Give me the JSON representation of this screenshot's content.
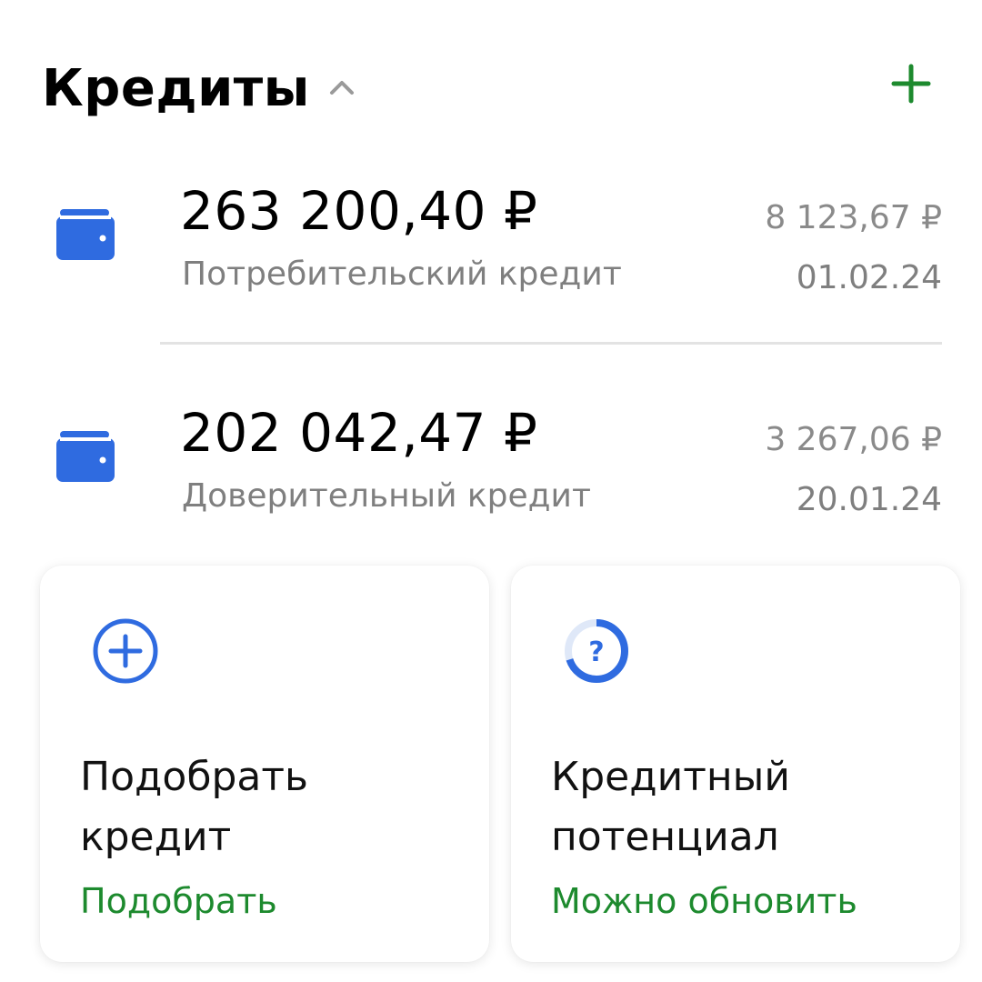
{
  "header": {
    "title": "Кредиты",
    "icons": {
      "collapse": "chevron-up-icon",
      "add": "plus-icon"
    }
  },
  "loans": [
    {
      "amount": "263 200,40 ₽",
      "name": "Потребительский кредит",
      "payment": "8 123,67 ₽",
      "date": "01.02.24",
      "icon": "wallet-icon"
    },
    {
      "amount": "202 042,47 ₽",
      "name": "Доверительный кредит",
      "payment": "3 267,06 ₽",
      "date": "20.01.24",
      "icon": "wallet-icon"
    }
  ],
  "cards": [
    {
      "title": "Подобрать кредит",
      "action": "Подобрать",
      "icon": "plus-circle-icon"
    },
    {
      "title": "Кредитный потенциал",
      "action": "Можно обновить",
      "icon": "question-progress-icon",
      "progress_percent": 70
    }
  ],
  "colors": {
    "accent_green": "#1d8a2e",
    "accent_blue": "#2f6be0",
    "secondary_text": "#7f7f7f"
  }
}
